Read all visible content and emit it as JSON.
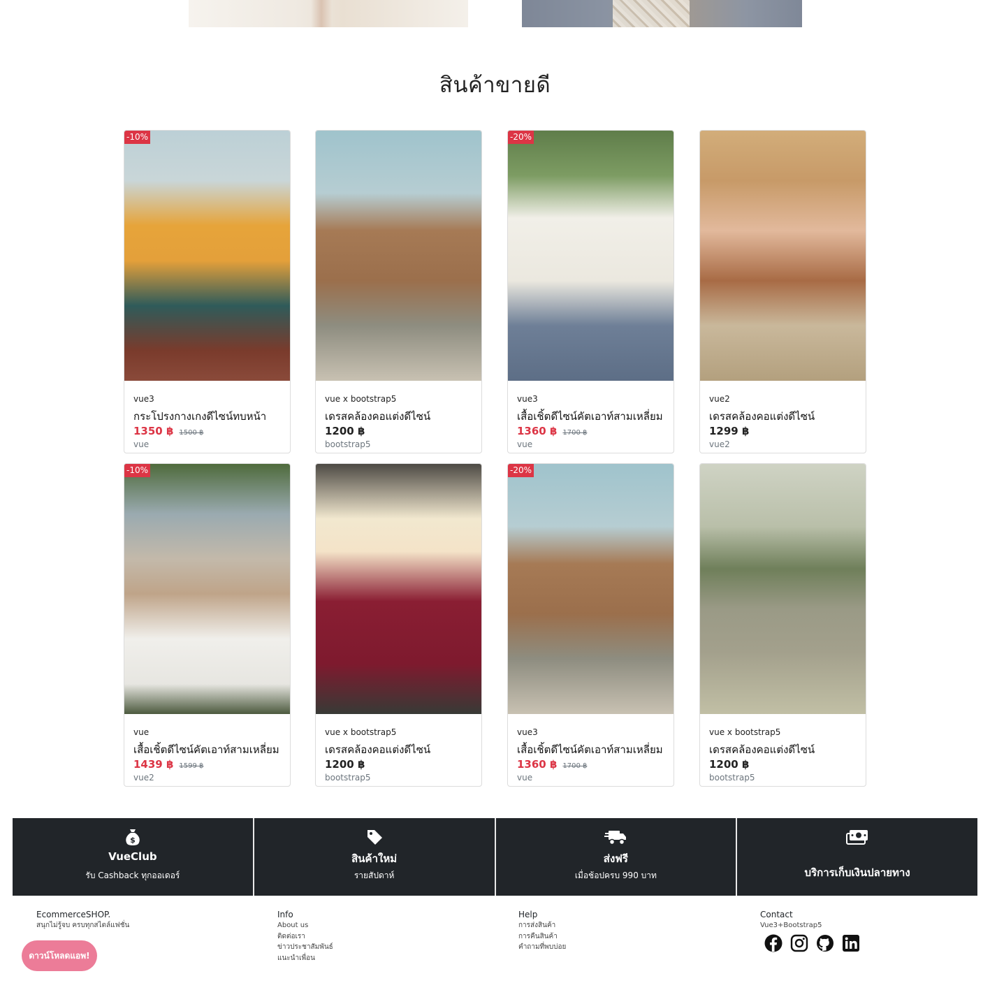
{
  "section_title": "สินค้าขายดี",
  "products": [
    {
      "badge": "-10%",
      "brand": "vue3",
      "name": "กระโปรงกางเกงดีไซน์ทบหน้า",
      "price": "1350 ฿",
      "old_price": "1500 ฿",
      "tag": "vue",
      "on_sale": true
    },
    {
      "badge": "",
      "brand": "vue x bootstrap5",
      "name": "เดรสคล้องคอแต่งดีไซน์",
      "price": "1200 ฿",
      "old_price": "",
      "tag": "bootstrap5",
      "on_sale": false
    },
    {
      "badge": "-20%",
      "brand": "vue3",
      "name": "เสื้อเชิ้ตดีไซน์คัตเอาท์สามเหลี่ยม",
      "price": "1360 ฿",
      "old_price": "1700 ฿",
      "tag": "vue",
      "on_sale": true
    },
    {
      "badge": "",
      "brand": "vue2",
      "name": "เดรสคล้องคอแต่งดีไซน์",
      "price": "1299 ฿",
      "old_price": "",
      "tag": "vue2",
      "on_sale": false
    },
    {
      "badge": "-10%",
      "brand": "vue",
      "name": "เสื้อเชิ้ตดีไซน์คัตเอาท์สามเหลี่ยม",
      "price": "1439 ฿",
      "old_price": "1599 ฿",
      "tag": "vue2",
      "on_sale": true
    },
    {
      "badge": "",
      "brand": "vue x bootstrap5",
      "name": "เดรสคล้องคอแต่งดีไซน์",
      "price": "1200 ฿",
      "old_price": "",
      "tag": "bootstrap5",
      "on_sale": false
    },
    {
      "badge": "-20%",
      "brand": "vue3",
      "name": "เสื้อเชิ้ตดีไซน์คัตเอาท์สามเหลี่ยม",
      "price": "1360 ฿",
      "old_price": "1700 ฿",
      "tag": "vue",
      "on_sale": true
    },
    {
      "badge": "",
      "brand": "vue x bootstrap5",
      "name": "เดรสคล้องคอแต่งดีไซน์",
      "price": "1200 ฿",
      "old_price": "",
      "tag": "bootstrap5",
      "on_sale": false
    }
  ],
  "features": [
    {
      "icon": "money-bag-icon",
      "title": "VueClub",
      "subtitle": "รับ Cashback ทุกออเดอร์"
    },
    {
      "icon": "tag-icon",
      "title": "สินค้าใหม่",
      "subtitle": "รายสัปดาห์"
    },
    {
      "icon": "delivery-truck-icon",
      "title": "ส่งฟรี",
      "subtitle": "เมื่อช้อปครบ 990 บาท"
    },
    {
      "icon": "cash-icon",
      "title": "บริการเก็บเงินปลายทาง",
      "subtitle": ""
    }
  ],
  "footer": {
    "brand": {
      "name": "EcommerceSHOP.",
      "tagline": "สนุกไม่รู้จบ ครบทุกสไตล์แฟชั่น"
    },
    "download_app": "ดาวน์โหลดแอพ!",
    "info": {
      "title": "Info",
      "links": [
        "About us",
        "ติดต่อเรา",
        "ข่าวประชาสัมพันธ์",
        "แนะนำเพื่อน"
      ]
    },
    "help": {
      "title": "Help",
      "links": [
        "การส่งสินค้า",
        "การคืนสินค้า",
        "คำถามที่พบบ่อย"
      ]
    },
    "contact": {
      "title": "Contact",
      "subtitle": "Vue3+Bootstrap5",
      "socials": [
        "facebook-icon",
        "instagram-icon",
        "github-icon",
        "linkedin-icon"
      ]
    }
  },
  "colors": {
    "sale_red": "#dc3545",
    "feature_bar": "#212529",
    "app_button": "#ec7c98"
  }
}
